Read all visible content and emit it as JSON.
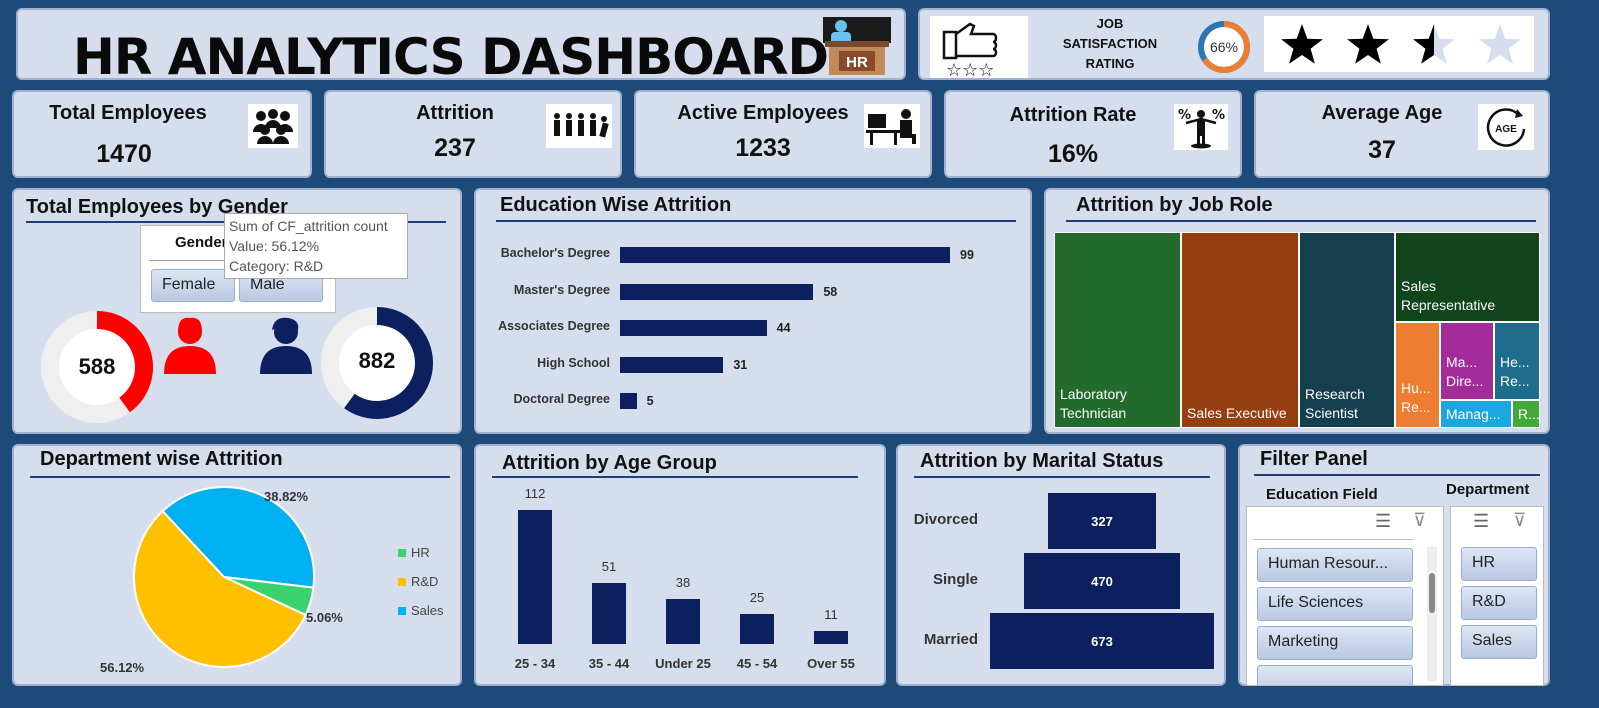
{
  "header": {
    "title": "HR ANALYTICS DASHBOARD",
    "hr_badge": "HR",
    "job_satisfaction_label": [
      "JOB",
      "SATISFACTION",
      "RATING"
    ],
    "job_satisfaction_pct": "66%",
    "job_satisfaction_value": 0.66,
    "star_rating": 2.5,
    "star_max": 4
  },
  "kpis": [
    {
      "label": "Total Employees",
      "value": "1470",
      "icon": "group-icon"
    },
    {
      "label": "Attrition",
      "value": "237",
      "icon": "people-leaving-icon"
    },
    {
      "label": "Active Employees",
      "value": "1233",
      "icon": "worker-at-desk-icon"
    },
    {
      "label": "Attrition Rate",
      "value": "16%",
      "icon": "balance-person-icon"
    },
    {
      "label": "Average Age",
      "value": "37",
      "icon": "age-cycle-icon"
    }
  ],
  "gender": {
    "title": "Total Employees by Gender",
    "slicer_title": "Gender",
    "slicer_options": [
      "Female",
      "Male"
    ],
    "female_value": "588",
    "male_value": "882",
    "female_color": "#ff0000",
    "male_color": "#0c1f5e",
    "tooltip": [
      "Sum of CF_attrition count",
      "Value: 56.12%",
      "Category: R&D"
    ]
  },
  "education": {
    "title": "Education Wise Attrition"
  },
  "job_role": {
    "title": "Attrition by Job Role",
    "cells": [
      "Laboratory\nTechnician",
      "Sales Executive",
      "Research\nScientist",
      "Sales\nRepresentative",
      "Hu...\nRe...",
      "Ma...\nDire...",
      "He...\nRe...",
      "Manag...",
      "R..."
    ]
  },
  "department": {
    "title": "Department wise Attrition",
    "labels": [
      "38.82%",
      "5.06%",
      "56.12%"
    ]
  },
  "age": {
    "title": "Attrition by Age Group"
  },
  "marital": {
    "title": "Attrition by Marital Status"
  },
  "filter": {
    "title": "Filter Panel",
    "education_field_label": "Education Field",
    "education_field_options": [
      "Human Resour...",
      "Life Sciences",
      "Marketing"
    ],
    "department_label": "Department",
    "department_options": [
      "HR",
      "R&D",
      "Sales"
    ]
  },
  "chart_data": [
    {
      "type": "bar",
      "title": "Education Wise Attrition",
      "categories": [
        "Bachelor's Degree",
        "Master's Degree",
        "Associates Degree",
        "High School",
        "Doctoral Degree"
      ],
      "values": [
        99,
        58,
        44,
        31,
        5
      ]
    },
    {
      "type": "heatmap",
      "title": "Attrition by Job Role",
      "categories": [
        "Laboratory Technician",
        "Sales Executive",
        "Research Scientist",
        "Sales Representative",
        "Human Resources",
        "Manager Director",
        "Healthcare Representative",
        "Manager",
        "Research Director"
      ]
    },
    {
      "type": "pie",
      "title": "Department wise Attrition",
      "categories": [
        "HR",
        "R&D",
        "Sales"
      ],
      "values": [
        5.06,
        56.12,
        38.82
      ],
      "colors": [
        "#3bd16f",
        "#ffc000",
        "#00b0f0"
      ],
      "legend": "right"
    },
    {
      "type": "bar",
      "title": "Attrition by Age Group",
      "categories": [
        "25 - 34",
        "35 - 44",
        "Under 25",
        "45 - 54",
        "Over 55"
      ],
      "values": [
        112,
        51,
        38,
        25,
        11
      ]
    },
    {
      "type": "bar",
      "title": "Attrition by Marital Status",
      "categories": [
        "Divorced",
        "Single",
        "Married"
      ],
      "values": [
        327,
        470,
        673
      ]
    }
  ]
}
